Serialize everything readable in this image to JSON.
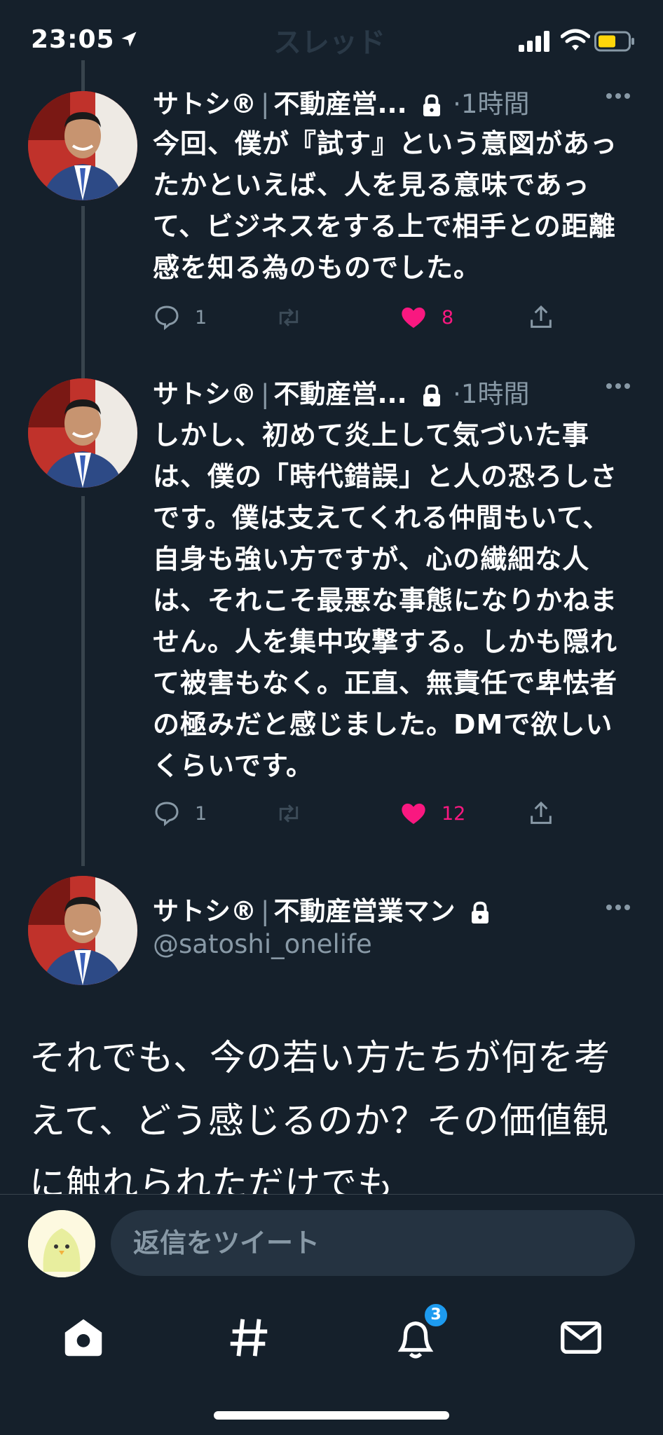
{
  "status": {
    "time": "23:05"
  },
  "ghost_header": "スレッド",
  "tweets": [
    {
      "name": "サトシ®",
      "name_suffix": "不動産営...",
      "time": "·1時間",
      "text": "今回、僕が『試す』という意図があったかといえば、人を見る意味であって、ビジネスをする上で相手との距離感を知る為のものでした。",
      "reply_count": "1",
      "like_count": "8"
    },
    {
      "name": "サトシ®",
      "name_suffix": "不動産営...",
      "time": "·1時間",
      "text": "しかし、初めて炎上して気づいた事は、僕の「時代錯誤」と人の恐ろしさです。僕は支えてくれる仲間もいて、自身も強い方ですが、心の繊細な人は、それこそ最悪な事態になりかねません。人を集中攻撃する。しかも隠れて被害もなく。正直、無責任で卑怯者の極みだと感じました。DMで欲しいくらいです。",
      "reply_count": "1",
      "like_count": "12"
    }
  ],
  "main_tweet": {
    "name": "サトシ®",
    "name_suffix": "不動産営業マン",
    "handle": "@satoshi_onelife",
    "text": "それでも、今の若い方たちが何を考えて、どう感じるのか？その価値観に触れられただけでも"
  },
  "reply": {
    "placeholder": "返信をツイート"
  },
  "tabs": {
    "notification_badge": "3"
  },
  "colors": {
    "background": "#15202b",
    "secondary_text": "#8899a6",
    "like": "#f91880",
    "accent": "#1d9bf0"
  }
}
